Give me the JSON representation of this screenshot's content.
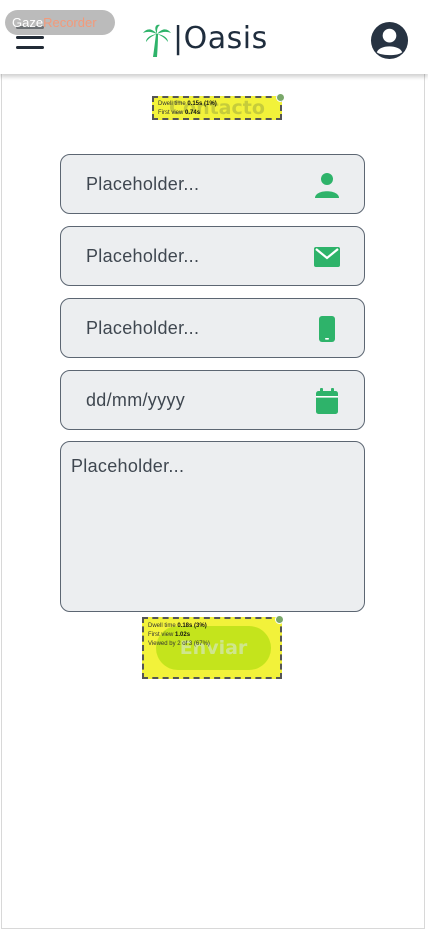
{
  "recorder_badge": {
    "part1": "Gaze",
    "part2": "Recorder"
  },
  "header": {
    "brand": "|Oasis",
    "menu_icon": "hamburger-menu-icon",
    "profile_icon": "user-circle-icon",
    "logo_icon": "palm-tree-icon"
  },
  "page_title": "Contacto",
  "title_stats": {
    "dwell_label": "Dwell time",
    "dwell_value": "0.15s (1%)",
    "first_view_label": "First view",
    "first_view_value": "0.74s"
  },
  "form": {
    "name_placeholder": "Placeholder...",
    "email_placeholder": "Placeholder...",
    "phone_placeholder": "Placeholder...",
    "date_placeholder": "dd/mm/yyyy",
    "message_placeholder": "Placeholder...",
    "icons": {
      "name": "person-icon",
      "email": "envelope-icon",
      "phone": "smartphone-icon",
      "date": "calendar-icon"
    },
    "submit_label": "Enviar"
  },
  "submit_stats": {
    "dwell_label": "Dwell time",
    "dwell_value": "0.18s (3%)",
    "first_view_label": "First view",
    "first_view_value": "1.02s",
    "viewed_by_label": "Viewed by",
    "viewed_by_value": "2 of 3 (67%)"
  },
  "colors": {
    "icon_green": "#2eb36a",
    "field_bg": "#eceef0",
    "heatmap_yellow": "#f2f23a",
    "button_green": "#c4e41c",
    "navy": "#1f2d3d"
  }
}
